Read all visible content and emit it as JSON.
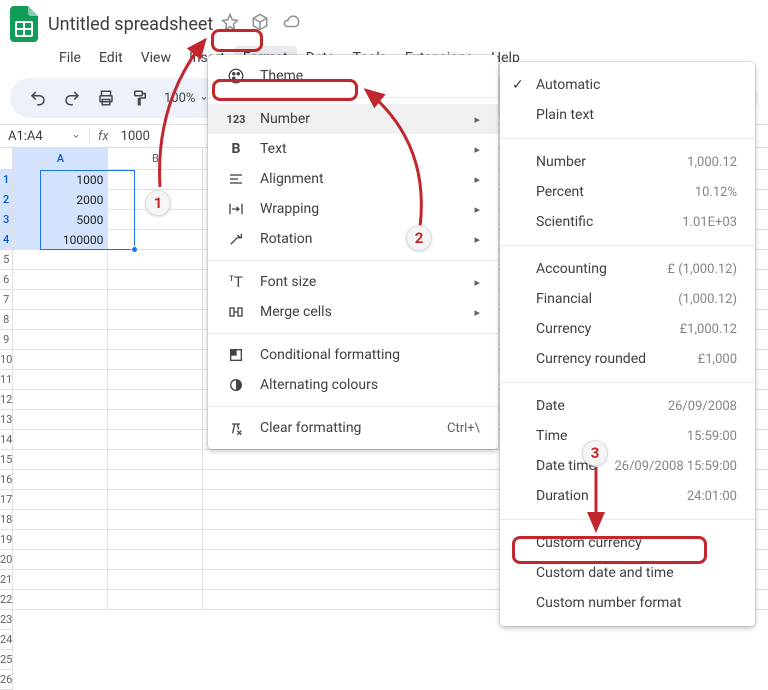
{
  "doc_title": "Untitled spreadsheet",
  "menus": {
    "file": "File",
    "edit": "Edit",
    "view": "View",
    "insert": "Insert",
    "format": "Format",
    "data": "Data",
    "tools": "Tools",
    "extensions": "Extensions",
    "help": "Help"
  },
  "toolbar": {
    "zoom": "100%"
  },
  "name_box": "A1:A4",
  "fx_label": "fx",
  "fx_value": "1000",
  "columns": [
    "A",
    "B"
  ],
  "cells": {
    "A1": "1000",
    "A2": "2000",
    "A3": "5000",
    "A4": "100000"
  },
  "format_menu": {
    "theme": "Theme",
    "number": "Number",
    "text": "Text",
    "alignment": "Alignment",
    "wrapping": "Wrapping",
    "rotation": "Rotation",
    "font_size": "Font size",
    "merge": "Merge cells",
    "conditional": "Conditional formatting",
    "alternating": "Alternating colours",
    "clear": "Clear formatting",
    "clear_shortcut": "Ctrl+\\"
  },
  "number_menu": {
    "automatic": "Automatic",
    "plain": "Plain text",
    "number": {
      "label": "Number",
      "ex": "1,000.12"
    },
    "percent": {
      "label": "Percent",
      "ex": "10.12%"
    },
    "scientific": {
      "label": "Scientific",
      "ex": "1.01E+03"
    },
    "accounting": {
      "label": "Accounting",
      "ex": "£ (1,000.12)"
    },
    "financial": {
      "label": "Financial",
      "ex": "(1,000.12)"
    },
    "currency": {
      "label": "Currency",
      "ex": "£1,000.12"
    },
    "currency_rounded": {
      "label": "Currency rounded",
      "ex": "£1,000"
    },
    "date": {
      "label": "Date",
      "ex": "26/09/2008"
    },
    "time": {
      "label": "Time",
      "ex": "15:59:00"
    },
    "datetime": {
      "label": "Date time",
      "ex": "26/09/2008 15:59:00"
    },
    "duration": {
      "label": "Duration",
      "ex": "24:01:00"
    },
    "custom_currency": "Custom currency",
    "custom_datetime": "Custom date and time",
    "custom_number": "Custom number format"
  },
  "annotations": {
    "n1": "1",
    "n2": "2",
    "n3": "3"
  }
}
